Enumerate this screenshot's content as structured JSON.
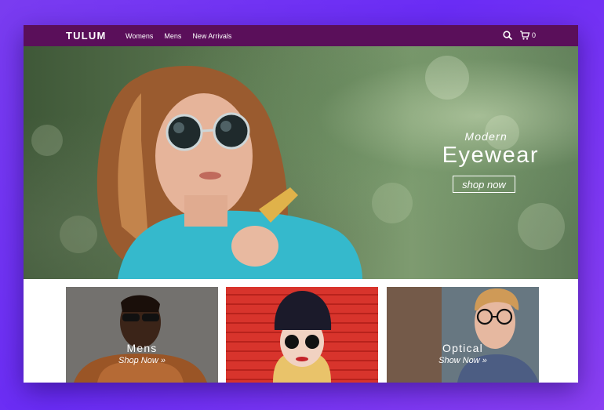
{
  "nav": {
    "brand": "TULUM",
    "menu": [
      "Womens",
      "Mens",
      "New Arrivals"
    ],
    "cart_count": "0",
    "icons": [
      "search-icon",
      "cart-icon"
    ]
  },
  "hero": {
    "subtitle": "Modern",
    "title": "Eyewear",
    "button": "shop now"
  },
  "tiles": [
    {
      "label": "Mens",
      "link": "Shop Now »"
    },
    {
      "label": "",
      "link": ""
    },
    {
      "label": "Optical",
      "link": "Show Now »"
    }
  ],
  "colors": {
    "nav_bg": "#5a0f5a",
    "page_bg": "#7a3cf0",
    "tile_red": "#d8342c"
  }
}
